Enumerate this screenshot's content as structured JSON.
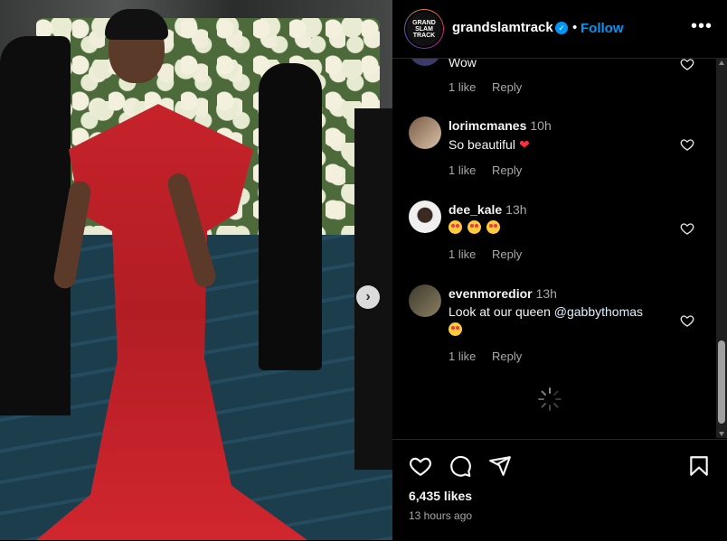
{
  "post": {
    "username": "grandslamtrack",
    "follow_label": "Follow",
    "dot": "•",
    "avatar_text": "GRAND SLAM TRACK"
  },
  "comments": [
    {
      "user": "",
      "time": "",
      "text": "Wow",
      "likes": "1 like",
      "reply": "Reply"
    },
    {
      "user": "lorimcmanes",
      "time": "10h",
      "text": "So beautiful",
      "likes": "1 like",
      "reply": "Reply"
    },
    {
      "user": "dee_kale",
      "time": "13h",
      "text": "",
      "likes": "1 like",
      "reply": "Reply"
    },
    {
      "user": "evenmoredior",
      "time": "13h",
      "text": "Look at our queen",
      "mention": "@gabbythomas",
      "likes": "1 like",
      "reply": "Reply"
    }
  ],
  "footer": {
    "likes": "6,435 likes",
    "ago": "13 hours ago"
  },
  "icons": {
    "like": "heart-icon",
    "comment": "comment-icon",
    "share": "share-icon",
    "save": "bookmark-icon",
    "more": "more-options-icon",
    "verified": "verified-badge-icon"
  },
  "colors": {
    "accent": "#0095f6",
    "background": "#000000",
    "dress": "#c8232b"
  }
}
